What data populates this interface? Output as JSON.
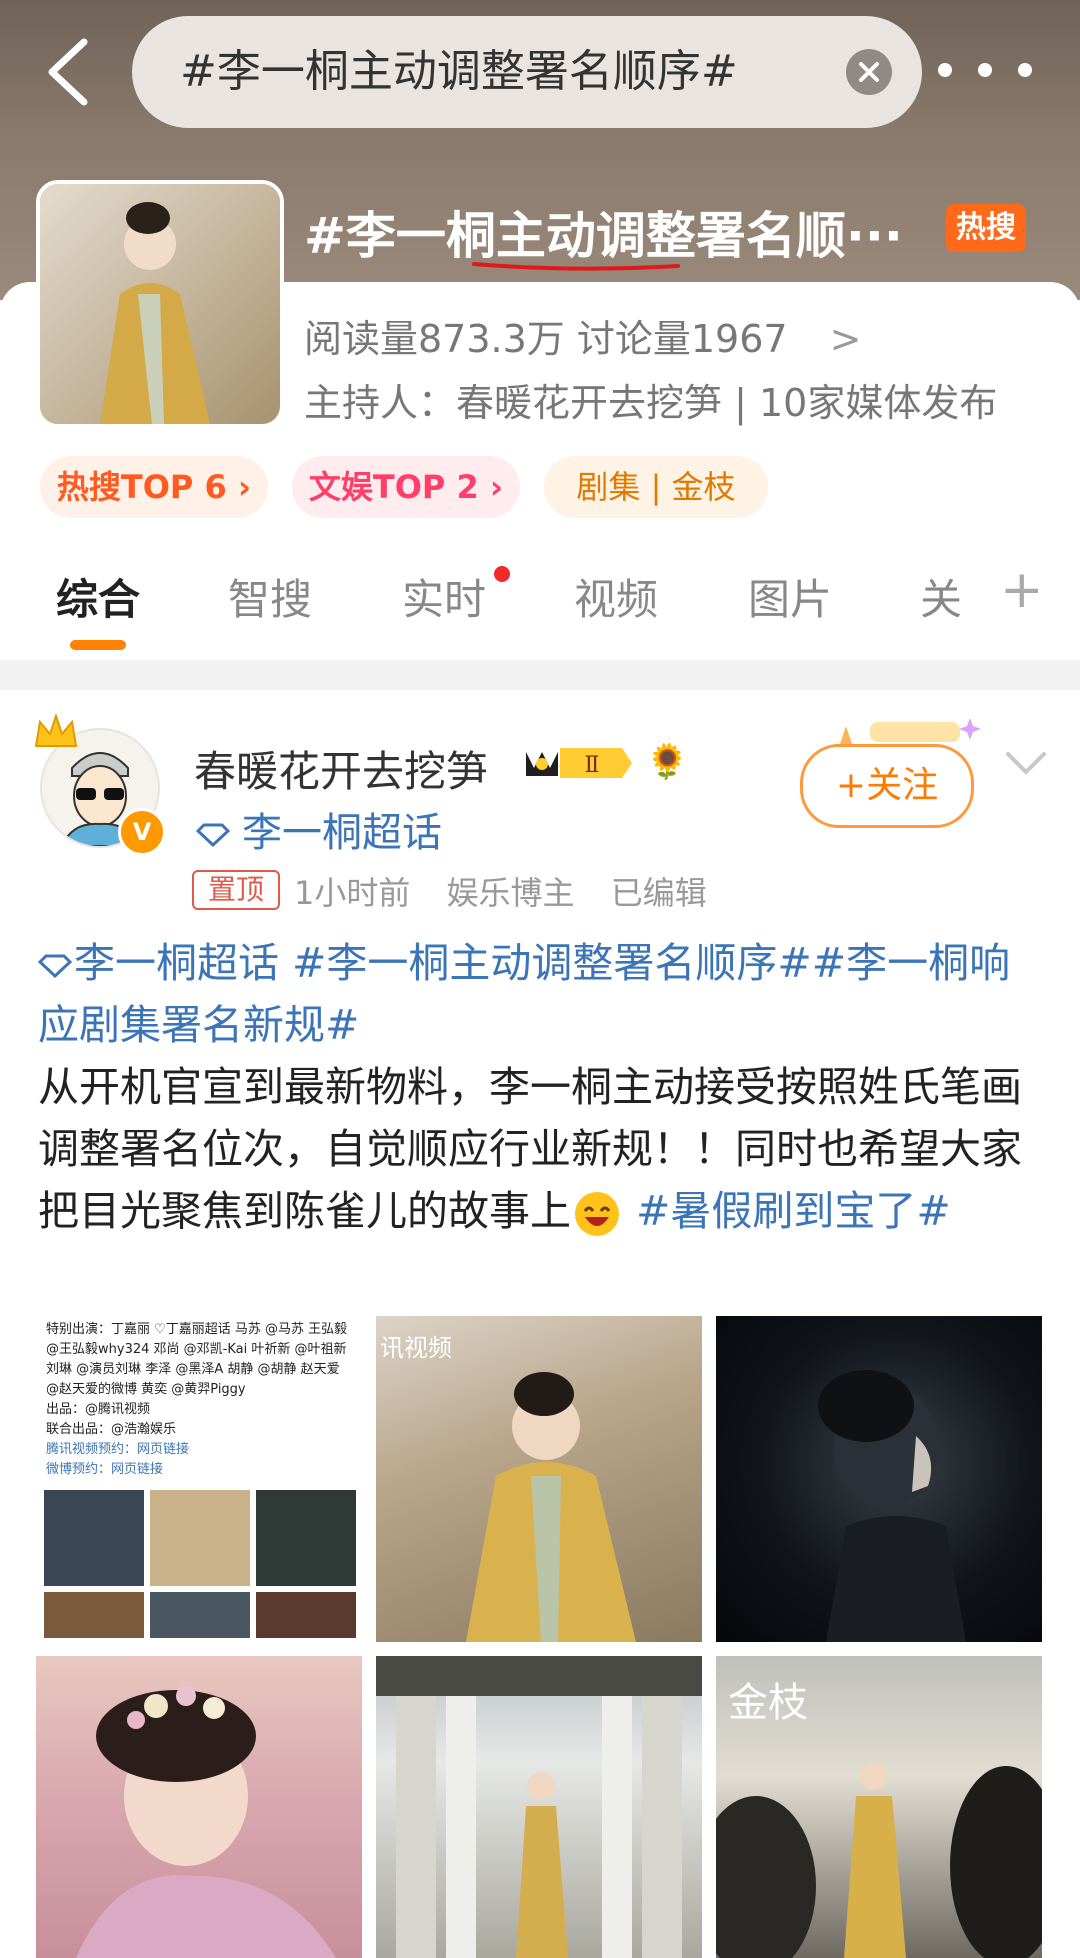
{
  "search": {
    "query": "#李一桐主动调整署名顺序#"
  },
  "topic": {
    "title": "#李一桐主动调整署名顺···",
    "hot_badge": "热搜",
    "stats": "阅读量873.3万  讨论量1967",
    "stats_chevron": ">",
    "host_line": "主持人：春暖花开去挖笋 | 10家媒体发布",
    "chips": [
      "热搜TOP 6 ›",
      "文娱TOP 2 ›",
      "剧集 | 金枝"
    ]
  },
  "tabs": [
    "综合",
    "智搜",
    "实时",
    "视频",
    "图片",
    "关"
  ],
  "tab_plus": "+",
  "post": {
    "username": "春暖花开去挖笋",
    "level_badge": "Ⅱ",
    "superchat": "李一桐超话",
    "follow_label": "+关注",
    "pinned": "置顶",
    "time": "1小时前",
    "role": "娱乐博主",
    "edited": "已编辑",
    "body_tag1": "李一桐超话",
    "body_tag2": " #李一桐主动调整署名顺序##李一桐响应剧集署名新规#",
    "body_text": "从开机官宣到最新物料，李一桐主动接受按照姓氏笔画调整署名位次，自觉顺应行业新规！！同时也希望大家把目光聚焦到陈雀儿的故事上",
    "body_tag3": " #暑假刷到宝了#"
  },
  "credits_image": {
    "lines": [
      "特别出演：丁嘉丽 ♡丁嘉丽超话 马苏 @马苏 王弘毅 @王弘毅why324 邓尚 @邓凯-Kai 叶祈新 @叶祖新 刘琳 @演员刘琳 李泽 @黑泽A 胡静 @胡静 赵天爱 @赵天爱的微博 黄奕 @黄羿Piggy",
      "出品：@腾讯视频",
      "联合出品：@浩瀚娱乐",
      "腾讯视频预约：网页链接",
      "微博预约：网页链接"
    ]
  },
  "photo_overlays": {
    "p2_watermark": "讯视频",
    "p6_logo": "金枝"
  },
  "colors": {
    "accent": "#ff8200",
    "link": "#3c74b8",
    "hot": "#ff6a1a"
  }
}
